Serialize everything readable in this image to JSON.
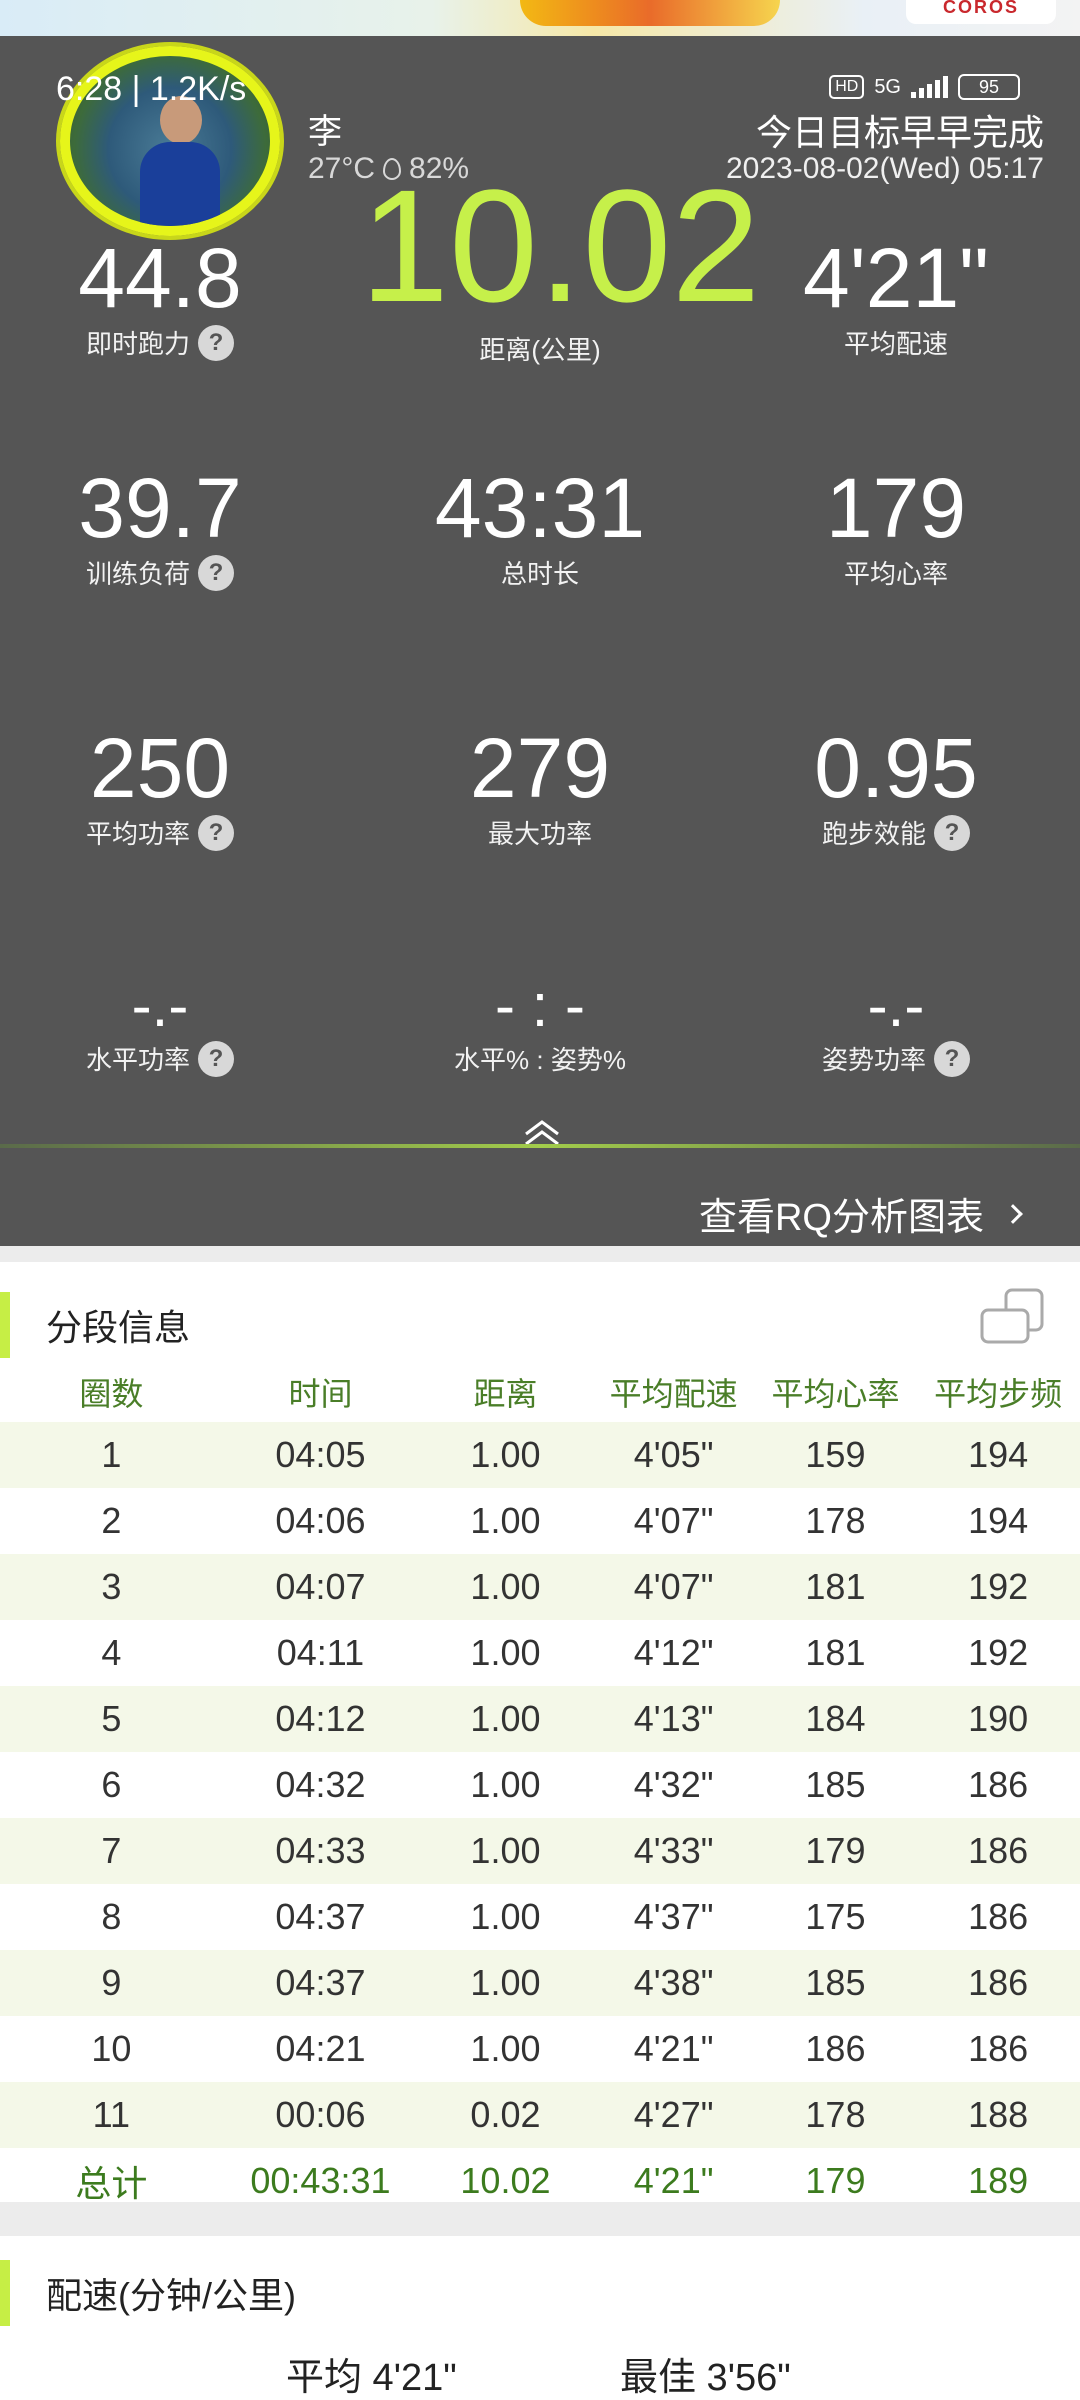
{
  "status_bar": {
    "time": "6:28 | 1.2K/s",
    "hd": "HD",
    "network": "5G",
    "battery": "95"
  },
  "brand": "COROS",
  "header": {
    "user_name": "李",
    "temperature": "27°C",
    "humidity": "82%",
    "goal_text": "今日目标早早完成",
    "datetime": "2023-08-02(Wed) 05:17"
  },
  "metrics": {
    "distance": {
      "value": "10.02",
      "label": "距离(公里)"
    },
    "running_power": {
      "value": "44.8",
      "label": "即时跑力"
    },
    "avg_pace": {
      "value": "4'21\"",
      "label": "平均配速"
    },
    "training_load": {
      "value": "39.7",
      "label": "训练负荷"
    },
    "total_time": {
      "value": "43:31",
      "label": "总时长"
    },
    "avg_hr": {
      "value": "179",
      "label": "平均心率"
    },
    "avg_power": {
      "value": "250",
      "label": "平均功率"
    },
    "max_power": {
      "value": "279",
      "label": "最大功率"
    },
    "running_efficiency": {
      "value": "0.95",
      "label": "跑步效能"
    },
    "horizontal_power": {
      "value": "-.-",
      "label": "水平功率"
    },
    "horizontal_form_ratio": {
      "value": "- : -",
      "label": "水平% : 姿势%"
    },
    "form_power": {
      "value": "-.-",
      "label": "姿势功率"
    }
  },
  "help_symbol": "?",
  "rq_link": "查看RQ分析图表",
  "splits": {
    "title": "分段信息",
    "columns": [
      "圈数",
      "时间",
      "距离",
      "平均配速",
      "平均心率",
      "平均步频"
    ],
    "rows": [
      [
        "1",
        "04:05",
        "1.00",
        "4'05\"",
        "159",
        "194"
      ],
      [
        "2",
        "04:06",
        "1.00",
        "4'07\"",
        "178",
        "194"
      ],
      [
        "3",
        "04:07",
        "1.00",
        "4'07\"",
        "181",
        "192"
      ],
      [
        "4",
        "04:11",
        "1.00",
        "4'12\"",
        "181",
        "192"
      ],
      [
        "5",
        "04:12",
        "1.00",
        "4'13\"",
        "184",
        "190"
      ],
      [
        "6",
        "04:32",
        "1.00",
        "4'32\"",
        "185",
        "186"
      ],
      [
        "7",
        "04:33",
        "1.00",
        "4'33\"",
        "179",
        "186"
      ],
      [
        "8",
        "04:37",
        "1.00",
        "4'37\"",
        "175",
        "186"
      ],
      [
        "9",
        "04:37",
        "1.00",
        "4'38\"",
        "185",
        "186"
      ],
      [
        "10",
        "04:21",
        "1.00",
        "4'21\"",
        "186",
        "186"
      ],
      [
        "11",
        "00:06",
        "0.02",
        "4'27\"",
        "178",
        "188"
      ]
    ],
    "total": [
      "总计",
      "00:43:31",
      "10.02",
      "4'21\"",
      "179",
      "189"
    ]
  },
  "pace": {
    "title": "配速(分钟/公里)",
    "avg": "平均 4'21\"",
    "best": "最佳 3'56\""
  },
  "colors": {
    "accent": "#c6f04a",
    "panel": "#555555",
    "table_header": "#4a7e28"
  }
}
